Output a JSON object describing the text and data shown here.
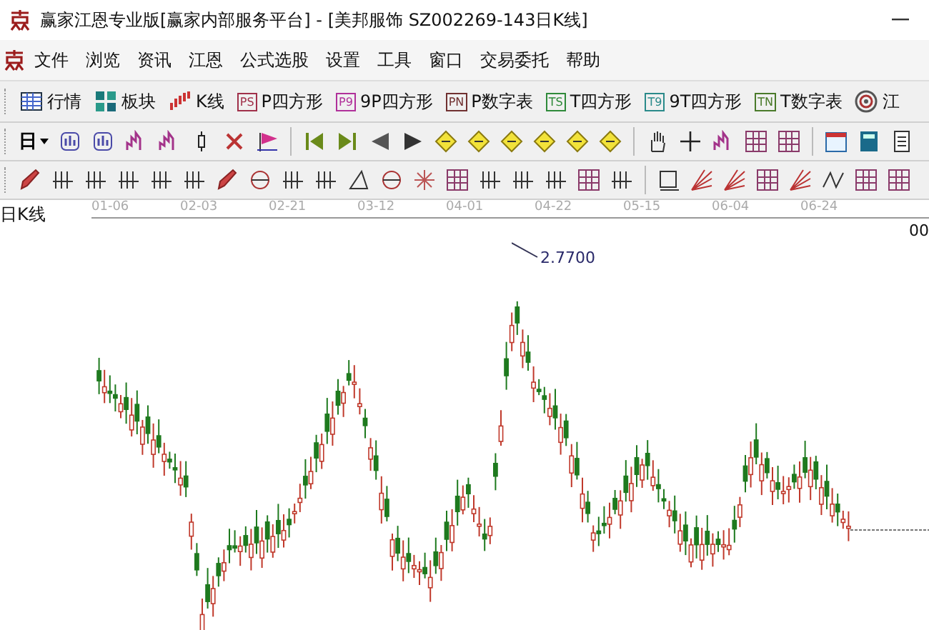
{
  "window": {
    "title": "赢家江恩专业版[赢家内部服务平台] - [美邦服饰  SZ002269-143日K线]"
  },
  "menu": [
    "文件",
    "浏览",
    "资讯",
    "江恩",
    "公式选股",
    "设置",
    "工具",
    "窗口",
    "交易委托",
    "帮助"
  ],
  "toolbar": [
    {
      "kind": "table",
      "label": "行情"
    },
    {
      "kind": "blocks",
      "label": "板块"
    },
    {
      "kind": "kline",
      "label": "K线"
    },
    {
      "kind": "badge",
      "badge": "PS",
      "color": "#a0304a",
      "label": "P四方形"
    },
    {
      "kind": "badge",
      "badge": "P9",
      "color": "#b0309a",
      "label": "9P四方形"
    },
    {
      "kind": "badge",
      "badge": "PN",
      "color": "#703030",
      "label": "P数字表"
    },
    {
      "kind": "badge",
      "badge": "TS",
      "color": "#2f8a3a",
      "label": "T四方形"
    },
    {
      "kind": "badge",
      "badge": "T9",
      "color": "#2a8a8a",
      "label": "9T四方形"
    },
    {
      "kind": "badge",
      "badge": "TN",
      "color": "#4a7a2a",
      "label": "T数字表"
    },
    {
      "kind": "target",
      "label": "江"
    }
  ],
  "period_button": {
    "label": "日"
  },
  "chart": {
    "title": "日K线",
    "dates": [
      "01-06",
      "02-03",
      "02-21",
      "03-12",
      "04-01",
      "04-22",
      "05-15",
      "06-04",
      "06-24"
    ],
    "edge_label": "00",
    "high_label": "2.7700"
  }
}
